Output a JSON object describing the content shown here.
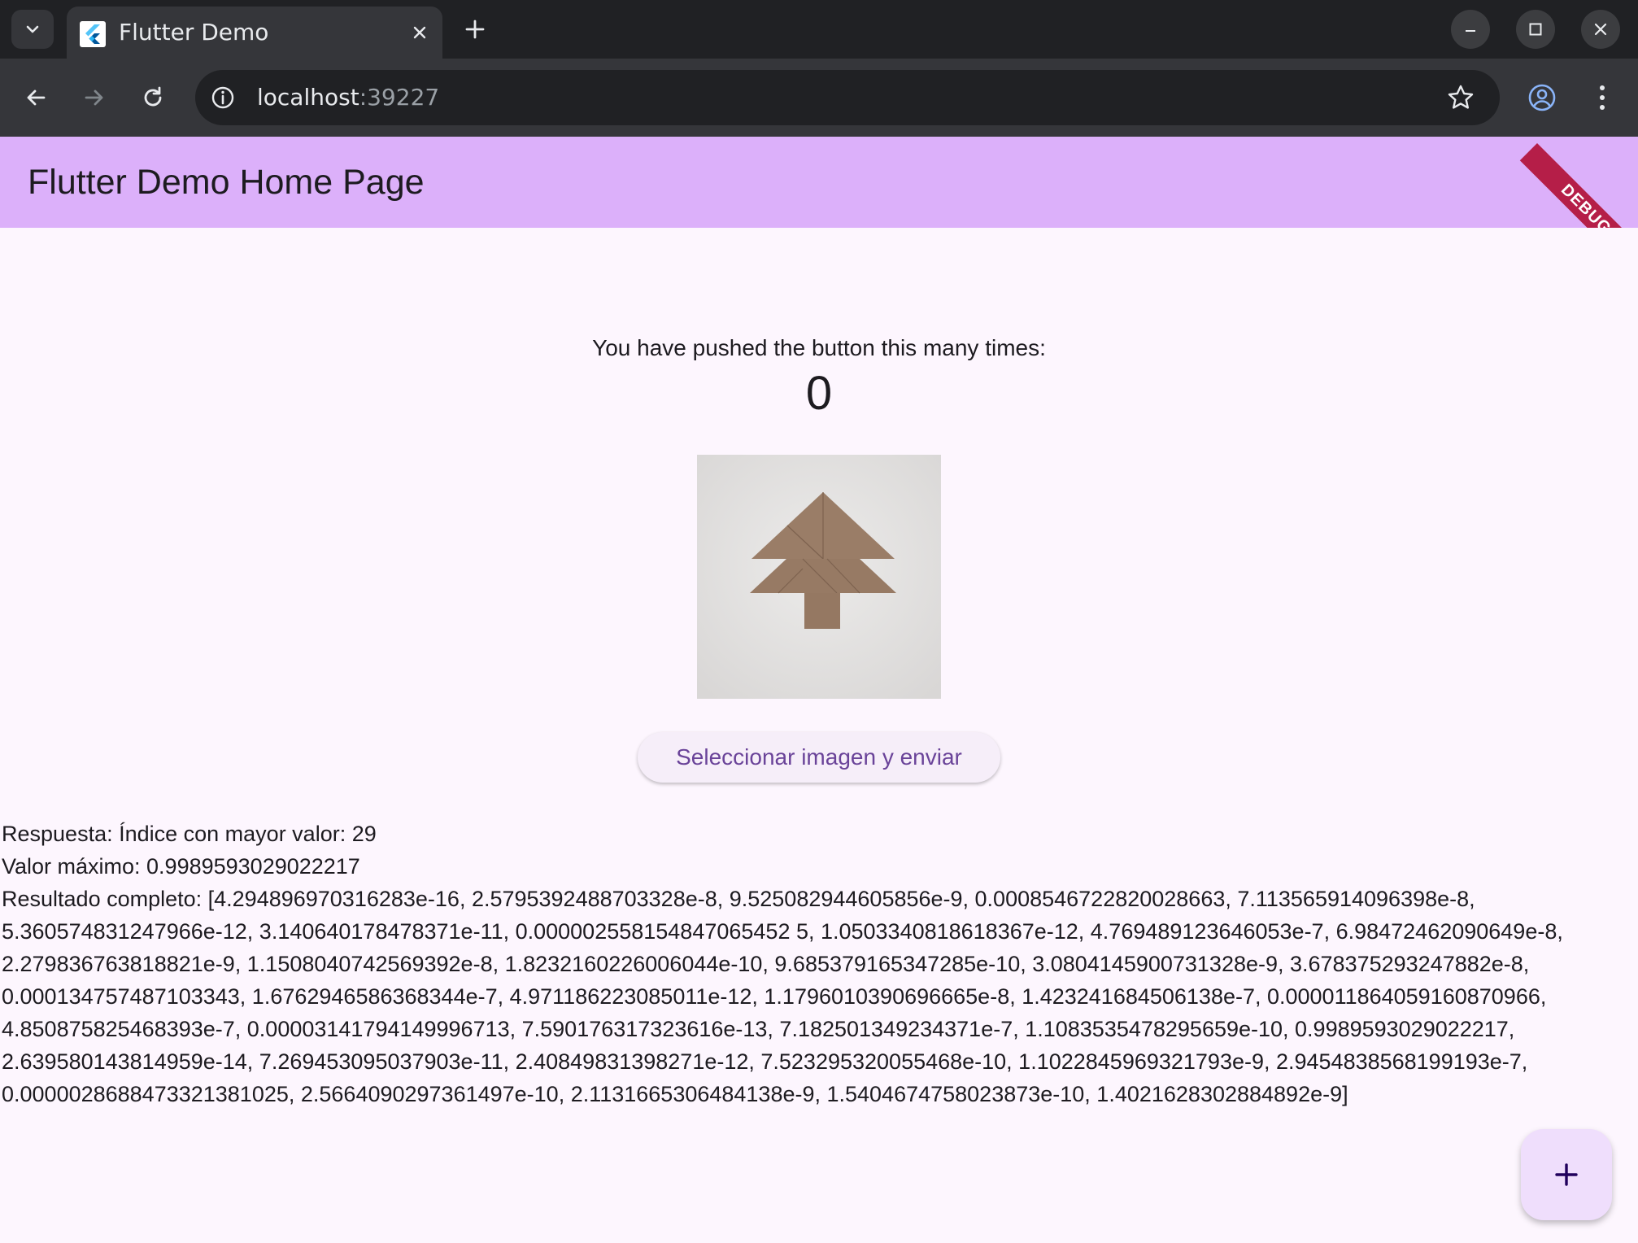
{
  "browser": {
    "tab_title": "Flutter Demo",
    "url_host": "localhost",
    "url_port": ":39227"
  },
  "app": {
    "title": "Flutter Demo Home Page",
    "debug_banner": "DEBUG",
    "accent_color": "#dcb0fa"
  },
  "counter": {
    "label": "You have pushed the button this many times:",
    "value": "0"
  },
  "actions": {
    "select_button": "Seleccionar imagen y enviar"
  },
  "response": {
    "index_line": "Respuesta: Índice con mayor valor: 29",
    "max_line": "Valor máximo: 0.9989593029022217",
    "full_result": "Resultado completo: [4.294896970316283e-16, 2.5795392488703328e-8, 9.525082944605856e-9, 0.0008546722820028663, 7.113565914096398e-8, 5.360574831247966e-12, 3.140640178478371e-11, 0.000002558154847065452 5, 1.0503340818618367e-12, 4.769489123646053e-7, 6.98472462090649e-8, 2.279836763818821e-9, 1.1508040742569392e-8, 1.8232160226006044e-10, 9.685379165347285e-10, 3.0804145900731328e-9, 3.678375293247882e-8, 0.000134757487103343, 1.6762946586368344e-7, 4.971186223085011e-12, 1.1796010390696665e-8, 1.423241684506138e-7, 0.000011864059160870966, 4.850875825468393e-7, 0.00003141794149996713, 7.590176317323616e-13, 7.182501349234371e-7, 1.1083535478295659e-10, 0.9989593029022217, 2.639580143814959e-14, 7.269453095037903e-11, 2.40849831398271e-12, 7.523295320055468e-10, 1.1022845969321793e-9, 2.9454838568199193e-7, 0.0000028688473321381025, 2.5664090297361497e-10, 2.1131665306484138e-9, 1.5404674758023873e-10, 1.4021628302884892e-9]"
  }
}
